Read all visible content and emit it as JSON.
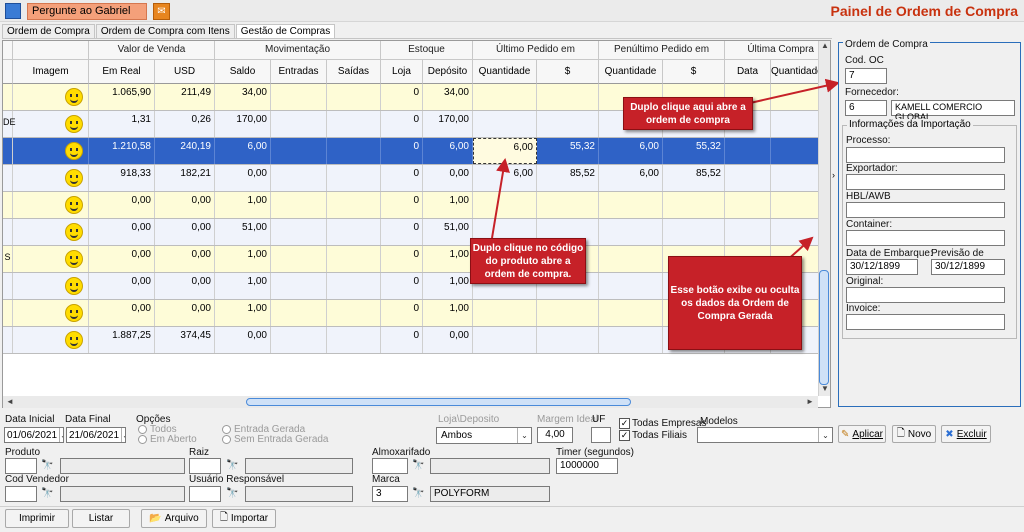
{
  "header": {
    "ask_label": "Pergunte ao Gabriel",
    "title": "Painel de Ordem de Compra"
  },
  "tabs": [
    "Ordem de Compra",
    "Ordem de Compra com Itens",
    "Gestão de Compras"
  ],
  "grid": {
    "groups": [
      "Valor de Venda",
      "Movimentação",
      "Estoque",
      "Último Pedido em Andamento",
      "Penúltimo Pedido em Andamento",
      "Última Compra"
    ],
    "columns": [
      "Imagem",
      "Em Real",
      "USD",
      "Saldo Anterior",
      "Entradas",
      "Saídas",
      "Loja",
      "Depósito",
      "Quantidade",
      "$",
      "Quantidade",
      "$",
      "Data",
      "Quantidade"
    ],
    "row_labels": [
      "",
      "DE",
      "",
      "",
      "",
      "",
      "S",
      "",
      "",
      ""
    ],
    "rows": [
      [
        "1.065,90",
        "211,49",
        "34,00",
        "",
        "",
        "0",
        "34,00",
        "",
        "",
        "",
        "",
        "",
        ""
      ],
      [
        "1,31",
        "0,26",
        "170,00",
        "",
        "",
        "0",
        "170,00",
        "",
        "",
        "",
        "",
        "",
        ""
      ],
      [
        "1.210,58",
        "240,19",
        "6,00",
        "",
        "",
        "0",
        "6,00",
        "6,00",
        "55,32",
        "6,00",
        "55,32",
        "",
        ""
      ],
      [
        "918,33",
        "182,21",
        "0,00",
        "",
        "",
        "0",
        "0,00",
        "6,00",
        "85,52",
        "6,00",
        "85,52",
        "",
        ""
      ],
      [
        "0,00",
        "0,00",
        "1,00",
        "",
        "",
        "0",
        "1,00",
        "",
        "",
        "",
        "",
        "",
        ""
      ],
      [
        "0,00",
        "0,00",
        "51,00",
        "",
        "",
        "0",
        "51,00",
        "",
        "",
        "",
        "",
        "",
        ""
      ],
      [
        "0,00",
        "0,00",
        "1,00",
        "",
        "",
        "0",
        "1,00",
        "",
        "",
        "",
        "",
        "",
        ""
      ],
      [
        "0,00",
        "0,00",
        "1,00",
        "",
        "",
        "0",
        "1,00",
        "",
        "",
        "",
        "",
        "",
        ""
      ],
      [
        "0,00",
        "0,00",
        "1,00",
        "",
        "",
        "0",
        "1,00",
        "",
        "",
        "",
        "",
        "",
        ""
      ],
      [
        "1.887,25",
        "374,45",
        "0,00",
        "",
        "",
        "0",
        "0,00",
        "",
        "",
        "",
        "",
        "",
        ""
      ]
    ]
  },
  "callouts": {
    "order": "Duplo clique aqui abre a ordem de compra",
    "code": "Duplo clique no código do produto abre a ordem de compra.",
    "toggle": "Esse botão exibe ou oculta os dados da Ordem de Compra Gerada"
  },
  "panel": {
    "group_title": "Ordem de Compra",
    "cod_oc_label": "Cod. OC",
    "cod_oc_value": "7",
    "fornecedor_label": "Fornecedor:",
    "fornecedor_code": "6",
    "fornecedor_name": "KAMELL COMERCIO GLOBAL",
    "import_title": "Informações da Importação",
    "processo_label": "Processo:",
    "exportador_label": "Exportador:",
    "hbl_label": "HBL/AWB",
    "container_label": "Container:",
    "embarque_label": "Data de Embarque:",
    "embarque_value": "30/12/1899",
    "chegada_label": "Previsão de Chegada:",
    "chegada_value": "30/12/1899",
    "original_label": "Original:",
    "invoice_label": "Invoice:"
  },
  "filters": {
    "data_inicial_label": "Data Inicial",
    "data_inicial_value": "01/06/2021",
    "data_final_label": "Data Final",
    "data_final_value": "21/06/2021",
    "opcoes_label": "Opções",
    "opt_todos": "Todos",
    "opt_em_aberto": "Em Aberto",
    "opt_entrada_gerada": "Entrada Gerada",
    "opt_sem_entrada": "Sem Entrada Gerada",
    "loja_deposito_label": "Loja\\Deposito",
    "loja_deposito_value": "Ambos",
    "margem_label": "Margem Ideal",
    "margem_value": "4,00",
    "uf_label": "UF",
    "todas_empresas": "Todas Empresas",
    "todas_filiais": "Todas Filiais",
    "modelos_label": "Modelos",
    "aplicar": "Aplicar",
    "novo": "Novo",
    "excluir": "Excluir",
    "produto_label": "Produto",
    "raiz_label": "Raiz",
    "almoxarifado_label": "Almoxarifado",
    "timer_label": "Timer (segundos)",
    "timer_value": "1000000",
    "cod_vendedor_label": "Cod Vendedor",
    "usuario_label": "Usuário Responsável",
    "marca_label": "Marca",
    "marca_code": "3",
    "marca_name": "POLYFORM"
  },
  "bottom": {
    "imprimir": "Imprimir",
    "listar": "Listar",
    "arquivo": "Arquivo",
    "importar": "Importar"
  }
}
